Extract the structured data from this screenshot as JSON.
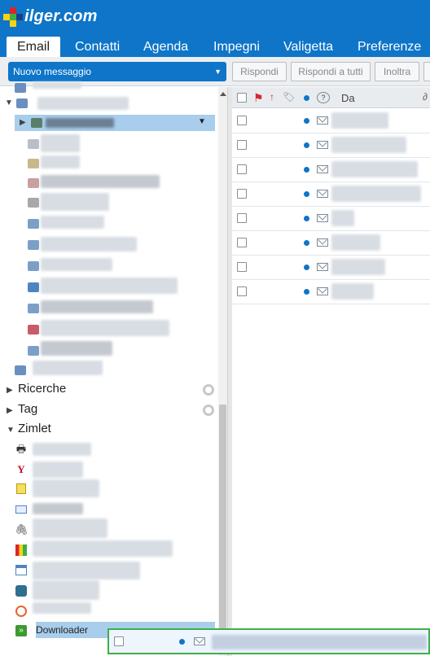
{
  "brand": {
    "logo_text": "ilger.com",
    "colors": {
      "primary": "#0e75c8",
      "accent_red": "#d9262c",
      "accent_yellow": "#f6d313",
      "accent_green": "#3fae49"
    }
  },
  "tabs": [
    {
      "label": "Email",
      "active": true
    },
    {
      "label": "Contatti",
      "active": false
    },
    {
      "label": "Agenda",
      "active": false
    },
    {
      "label": "Impegni",
      "active": false
    },
    {
      "label": "Valigetta",
      "active": false
    },
    {
      "label": "Preferenze",
      "active": false
    }
  ],
  "toolbar": {
    "new_message": "Nuovo messaggio",
    "reply": "Rispondi",
    "reply_all": "Rispondi a tutti",
    "forward": "Inoltra"
  },
  "tree": {
    "sections": {
      "searches": "Ricerche",
      "tags": "Tag",
      "zimlets": "Zimlet"
    },
    "zimlets": [
      {
        "icon": "printer-icon",
        "label": ""
      },
      {
        "icon": "yahoo-icon",
        "label": ""
      },
      {
        "icon": "sticky-note-icon",
        "label": ""
      },
      {
        "icon": "envelope-icon",
        "label": ""
      },
      {
        "icon": "paperclip-icon",
        "label": ""
      },
      {
        "icon": "color-square-icon",
        "label": ""
      },
      {
        "icon": "window-icon",
        "label": ""
      },
      {
        "icon": "gear-box-icon",
        "label": ""
      },
      {
        "icon": "orange-circle-icon",
        "label": ""
      },
      {
        "icon": "downloader-icon",
        "label": "Downloader"
      }
    ]
  },
  "list": {
    "header": {
      "from": "Da"
    },
    "rows": 8
  }
}
